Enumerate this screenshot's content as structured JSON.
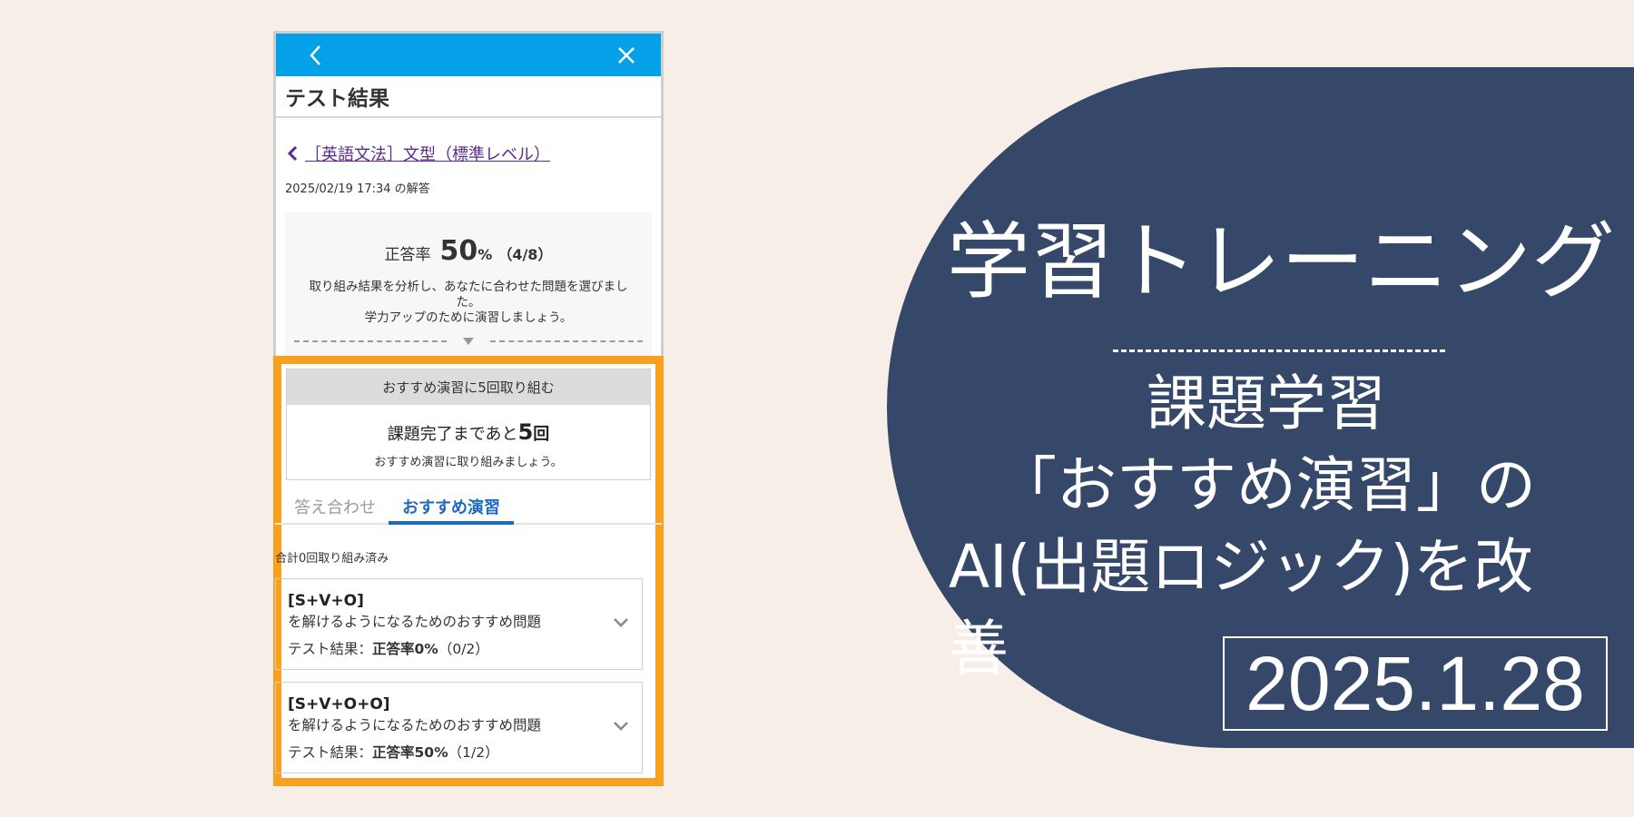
{
  "phone": {
    "screen_title": "テスト結果",
    "breadcrumb": "［英語文法］文型（標準レベル）",
    "answered_at": "2025/02/19 17:34 の解答",
    "score": {
      "label": "正答率",
      "value": "50",
      "unit": "%",
      "count": "（4/8）",
      "message": "取り組み結果を分析し、あなたに合わせた問題を選びました。\n学力アップのために演習しましょう。"
    },
    "task": {
      "header": "おすすめ演習に5回取り組む",
      "remaining_prefix": "課題完了まであと",
      "remaining_num": "5",
      "remaining_unit": "回",
      "note": "おすすめ演習に取り組みましょう。"
    },
    "tabs": [
      {
        "label": "答え合わせ",
        "active": false
      },
      {
        "label": "おすすめ演習",
        "active": true
      }
    ],
    "total_done": "合計0回取り組み済み",
    "questions": [
      {
        "title": "[S+V+O]",
        "desc": "を解けるようになるためのおすすめ問題",
        "result_label": "テスト結果：",
        "result_value": "正答率0%",
        "result_count": "（0/2）"
      },
      {
        "title": "[S+V+O+O]",
        "desc": "を解けるようになるためのおすすめ問題",
        "result_label": "テスト結果：",
        "result_value": "正答率50%",
        "result_count": "（1/2）"
      }
    ],
    "icons": {
      "back": "chevron-left-icon",
      "close": "close-icon",
      "expand": "chevron-down-icon"
    }
  },
  "hero": {
    "title": "学習トレーニング",
    "sub_line1": "課題学習",
    "sub_line2": "「おすすめ演習」の",
    "sub_line3": "AI(出題ロジック)を改善",
    "date": "2025.1.28"
  },
  "colors": {
    "background": "#f8eee8",
    "topbar": "#05a1e8",
    "highlight": "#f9a11e",
    "hero": "#354869",
    "tab_active": "#1e6ac0",
    "link": "#5a2a8e"
  }
}
